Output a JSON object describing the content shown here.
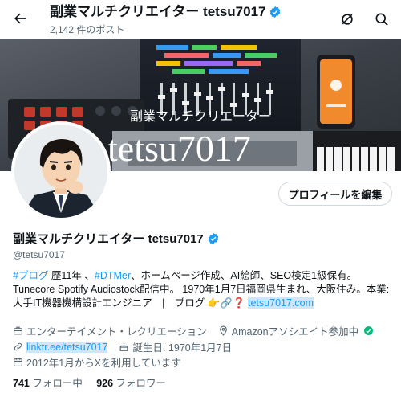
{
  "header": {
    "title": "副業マルチクリエイター tetsu7017",
    "posts_count": "2,142 件のポスト"
  },
  "banner": {
    "jp_text": "副業マルチクリエーター",
    "big_text": "tetsu7017"
  },
  "profile": {
    "edit_button": "プロフィールを編集",
    "name": "副業マルチクリエイター tetsu7017",
    "handle": "@tetsu7017",
    "bio": {
      "l1_tag1": "#ブログ",
      "l1_a": " 歴11年 、",
      "l1_tag2": "#DTMer",
      "l1_b": "、ホームページ作成、AI絵師、SEO検定1級保有。",
      "l2": "Tunecore Spotify Audiostock配信中。 1970年1月7日福岡県生まれ、大阪住み。本業:",
      "l3_a": "大手IT機器機構設計エンジニア　|　ブログ 👉🔗❓",
      "l3_link": "tetsu7017.com"
    },
    "meta": {
      "category": "エンターテイメント・レクリエーション",
      "location": "Amazonアソシエイト参加中",
      "url": "linktr.ee/tetsu7017",
      "birthday": "誕生日: 1970年1月7日",
      "joined": "2012年1月からXを利用しています"
    },
    "following_count": "741",
    "following_label": " フォロー中",
    "followers_count": "926",
    "followers_label": " フォロワー"
  },
  "colors": {
    "accent": "#1d9bf0",
    "muted": "#536471",
    "verified": "#1d9bf0",
    "green_check": "#00ba7c"
  },
  "icons": [
    "back-arrow-icon",
    "verified-icon",
    "grok-icon",
    "search-icon",
    "briefcase-icon",
    "location-icon",
    "link-icon",
    "calendar-icon",
    "green-check-icon"
  ]
}
